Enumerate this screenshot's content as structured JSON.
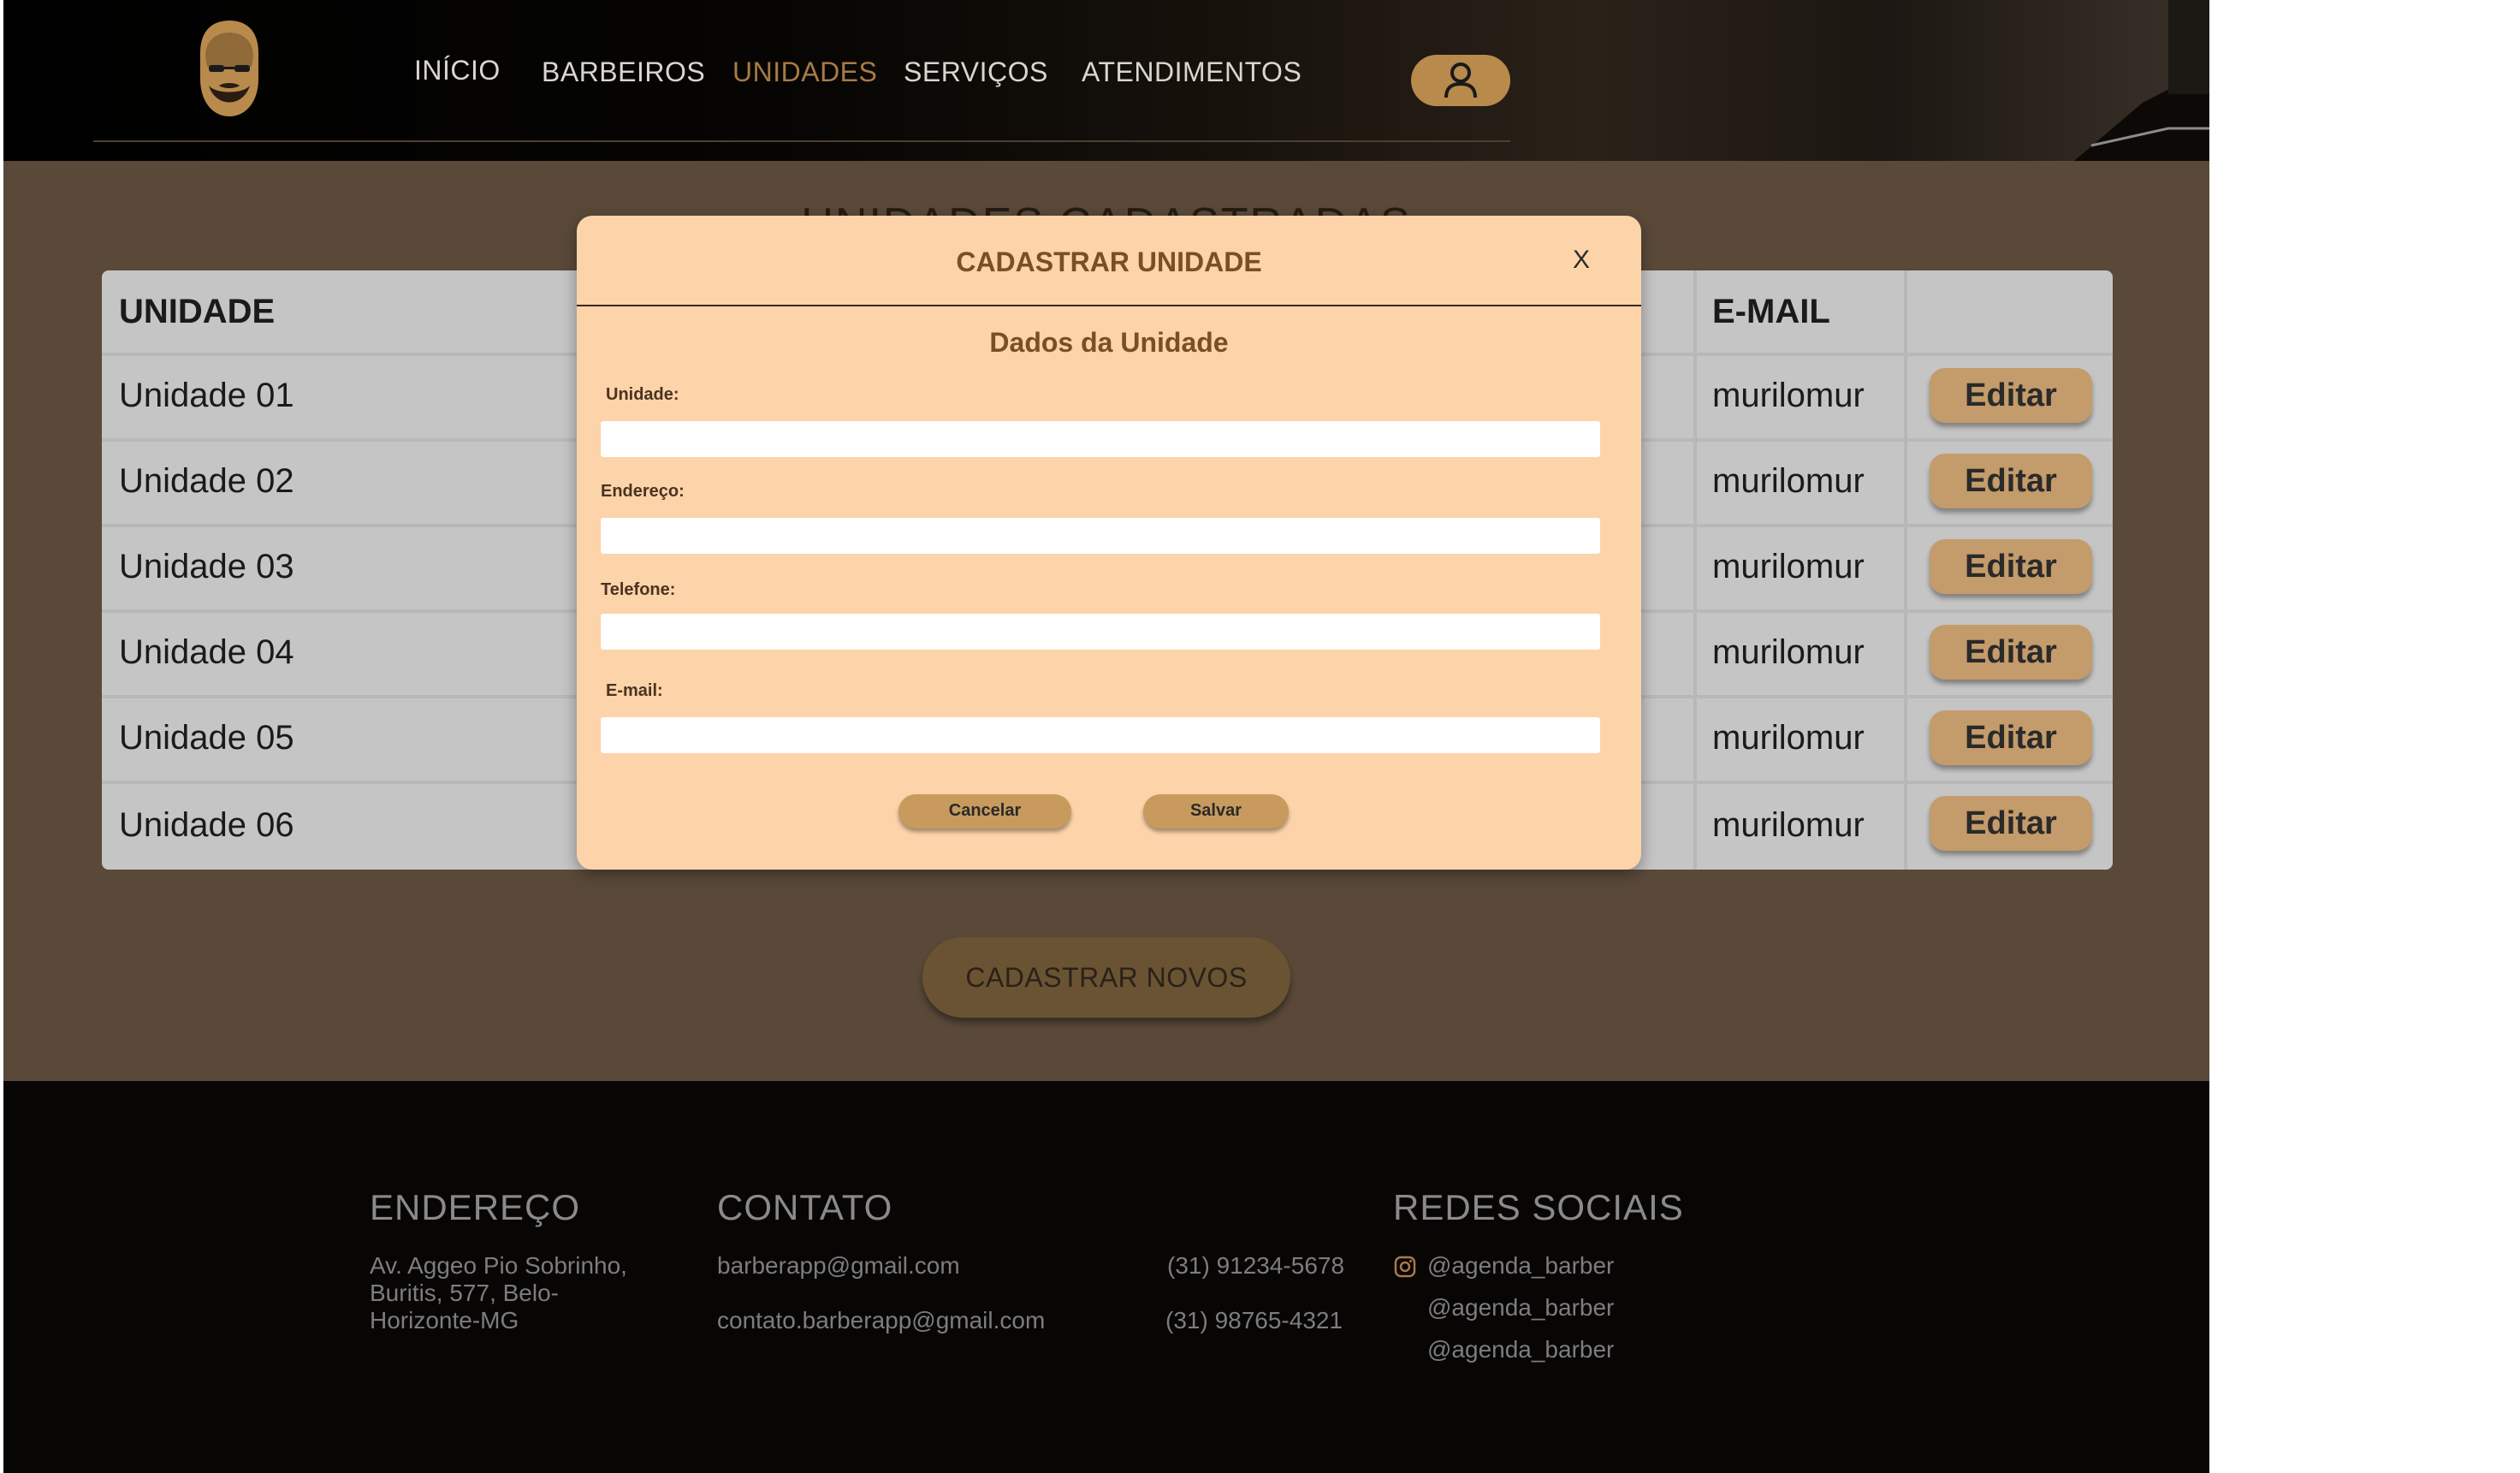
{
  "header": {
    "nav": [
      "INÍCIO",
      "BARBEIROS",
      "UNIDADES",
      "SERVIÇOS",
      "ATENDIMENTOS"
    ],
    "active_nav": "UNIDADES"
  },
  "main": {
    "title": "UNIDADES CADASTRADAS",
    "table": {
      "headers": {
        "unit": "UNIDADE",
        "email": "E-MAIL"
      },
      "rows": [
        {
          "unit": "Unidade 01",
          "email": "murilomur",
          "action": "Editar"
        },
        {
          "unit": "Unidade 02",
          "email": "murilomur",
          "action": "Editar"
        },
        {
          "unit": "Unidade 03",
          "email": "murilomur",
          "action": "Editar"
        },
        {
          "unit": "Unidade 04",
          "email": "murilomur",
          "action": "Editar"
        },
        {
          "unit": "Unidade 05",
          "email": "murilomur",
          "action": "Editar"
        },
        {
          "unit": "Unidade 06",
          "email": "murilomur",
          "action": "Editar"
        }
      ]
    },
    "register_button": "CADASTRAR NOVOS"
  },
  "modal": {
    "title": "CADASTRAR UNIDADE",
    "close": "X",
    "subtitle": "Dados da Unidade",
    "fields": [
      {
        "label": "Unidade:",
        "value": ""
      },
      {
        "label": "Endereço:",
        "value": ""
      },
      {
        "label": "Telefone:",
        "value": ""
      },
      {
        "label": "E-mail:",
        "value": ""
      }
    ],
    "cancel": "Cancelar",
    "save": "Salvar"
  },
  "footer": {
    "address": {
      "heading": "ENDEREÇO",
      "lines": [
        "Av. Aggeo Pio Sobrinho,",
        "Buritis, 577, Belo-",
        "Horizonte-MG"
      ]
    },
    "contact": {
      "heading": "CONTATO",
      "emails": [
        "barberapp@gmail.com",
        "contato.barberapp@gmail.com"
      ],
      "phones": [
        "(31) 91234-5678",
        "(31) 98765-4321"
      ]
    },
    "social": {
      "heading": "REDES SOCIAIS",
      "handles": [
        "@agenda_barber",
        "@agenda_barber",
        "@agenda_barber"
      ],
      "icon": "instagram-icon"
    }
  },
  "colors": {
    "accent": "#a77b45",
    "modal_bg": "#fdd3a9",
    "main_bg": "#5a4939",
    "footer_bg": "#080505"
  }
}
